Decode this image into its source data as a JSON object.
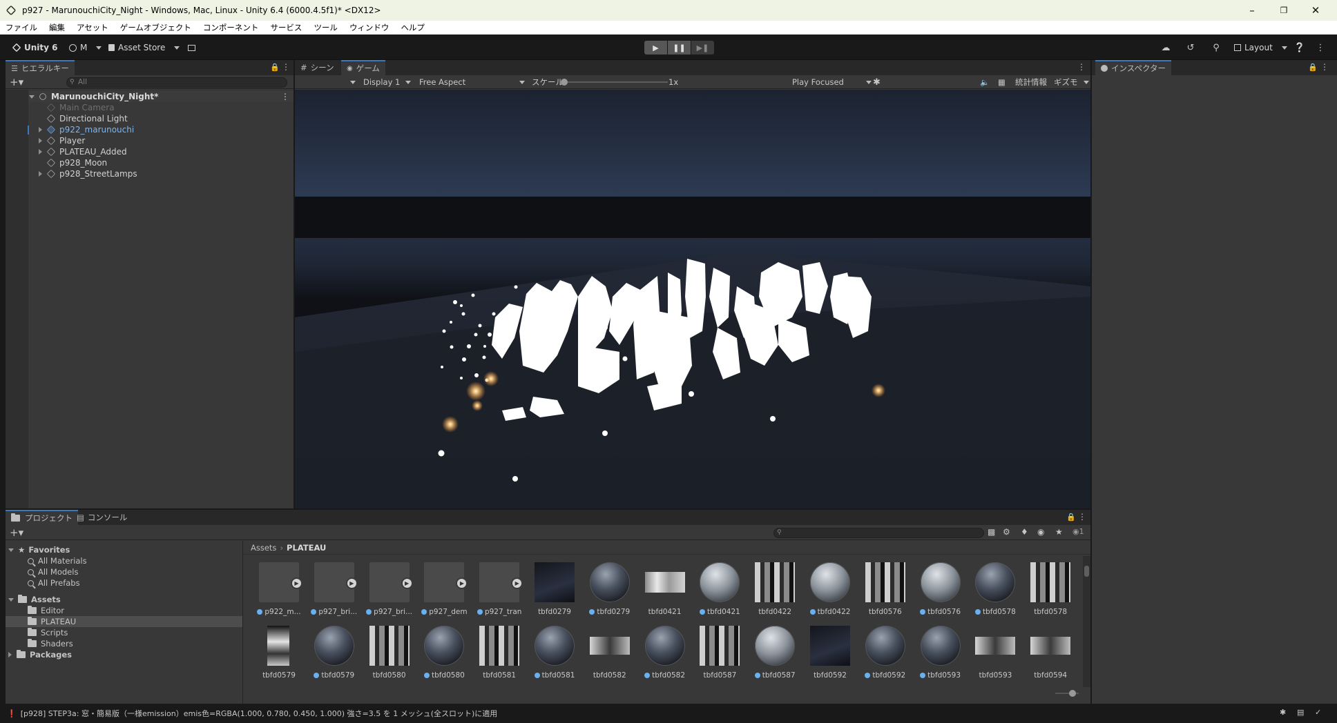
{
  "window": {
    "title": "p927 - MarunouchiCity_Night - Windows, Mac, Linux - Unity 6.4 (6000.4.5f1)* <DX12>"
  },
  "menu": [
    "ファイル",
    "編集",
    "アセット",
    "ゲームオブジェクト",
    "コンポーネント",
    "サービス",
    "ツール",
    "ウィンドウ",
    "ヘルプ"
  ],
  "toolbar": {
    "unity_label": "Unity 6",
    "account_label": "M",
    "asset_store_label": "Asset Store",
    "layout_label": "Layout"
  },
  "hierarchy": {
    "tab_label": "ヒエラルキー",
    "search_placeholder": "All",
    "scene_name": "MarunouchiCity_Night*",
    "items": [
      {
        "label": "Main Camera"
      },
      {
        "label": "Directional Light"
      },
      {
        "label": "p922_marunouchi"
      },
      {
        "label": "Player"
      },
      {
        "label": "PLATEAU_Added"
      },
      {
        "label": "p928_Moon"
      },
      {
        "label": "p928_StreetLamps"
      }
    ]
  },
  "game_view": {
    "tabs": [
      "シーン",
      "ゲーム"
    ],
    "display": "Display 1",
    "aspect": "Free Aspect",
    "scale_label": "スケール",
    "scale_value": "1x",
    "play_mode": "Play Focused",
    "stats_label": "統計情報",
    "gizmos_label": "ギズモ"
  },
  "inspector": {
    "tab_label": "インスペクター"
  },
  "project": {
    "tabs": [
      "プロジェクト",
      "コンソール"
    ],
    "favorites_label": "Favorites",
    "favorites": [
      "All Materials",
      "All Models",
      "All Prefabs"
    ],
    "assets_label": "Assets",
    "folders": [
      "Editor",
      "PLATEAU",
      "Scripts",
      "Shaders"
    ],
    "packages_label": "Packages",
    "breadcrumb": [
      "Assets",
      "PLATEAU"
    ],
    "visible_count": "1",
    "assets_row1": [
      "p922_m...",
      "p927_bri...",
      "p927_bri...",
      "p927_dem",
      "p927_tran",
      "tbfd0279",
      "tbfd0279",
      "tbfd0421",
      "tbfd0421",
      "tbfd0422",
      "tbfd0422",
      "tbfd0576",
      "tbfd0576",
      "tbfd0578",
      "tbfd0578"
    ],
    "assets_row2": [
      "tbfd0579",
      "tbfd0579",
      "tbfd0580",
      "tbfd0580",
      "tbfd0581",
      "tbfd0581",
      "tbfd0582",
      "tbfd0582",
      "tbfd0587",
      "tbfd0587",
      "tbfd0592",
      "tbfd0592",
      "tbfd0593",
      "tbfd0593",
      "tbfd0594"
    ]
  },
  "status": {
    "message": "[p928] STEP3a: 窓・簡易版（一様emission）emis色=RGBA(1.000, 0.780, 0.450, 1.000) 強さ=3.5 を 1 メッシュ(全スロット)に適用"
  }
}
